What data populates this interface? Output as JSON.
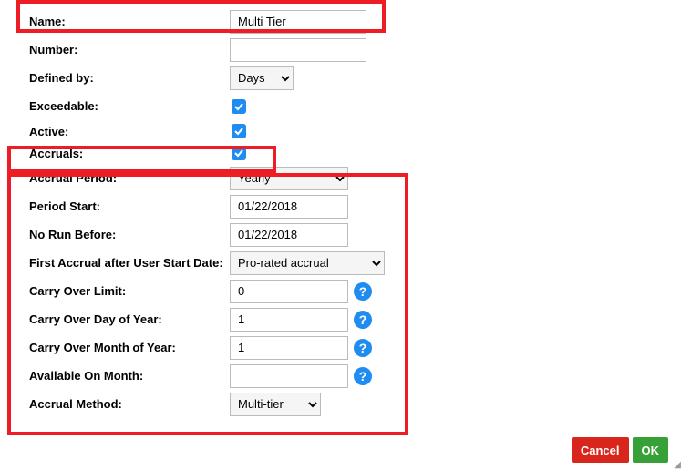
{
  "fields": {
    "name": {
      "label": "Name:",
      "value": "Multi Tier"
    },
    "number": {
      "label": "Number:",
      "value": ""
    },
    "defined_by": {
      "label": "Defined by:",
      "value": "Days"
    },
    "exceedable": {
      "label": "Exceedable:"
    },
    "active": {
      "label": "Active:"
    },
    "accruals": {
      "label": "Accruals:"
    },
    "accrual_period": {
      "label": "Accrual Period:",
      "value": "Yearly"
    },
    "period_start": {
      "label": "Period Start:",
      "value": "01/22/2018"
    },
    "no_run_before": {
      "label": "No Run Before:",
      "value": "01/22/2018"
    },
    "first_accrual": {
      "label": "First Accrual after User Start Date:",
      "value": "Pro-rated accrual"
    },
    "carry_limit": {
      "label": "Carry Over Limit:",
      "value": "0"
    },
    "carry_day": {
      "label": "Carry Over Day of Year:",
      "value": "1"
    },
    "carry_month": {
      "label": "Carry Over Month of Year:",
      "value": "1"
    },
    "avail_month": {
      "label": "Available On Month:",
      "value": ""
    },
    "accrual_method": {
      "label": "Accrual Method:",
      "value": "Multi-tier"
    }
  },
  "help_glyph": "?",
  "buttons": {
    "cancel": "Cancel",
    "ok": "OK"
  }
}
